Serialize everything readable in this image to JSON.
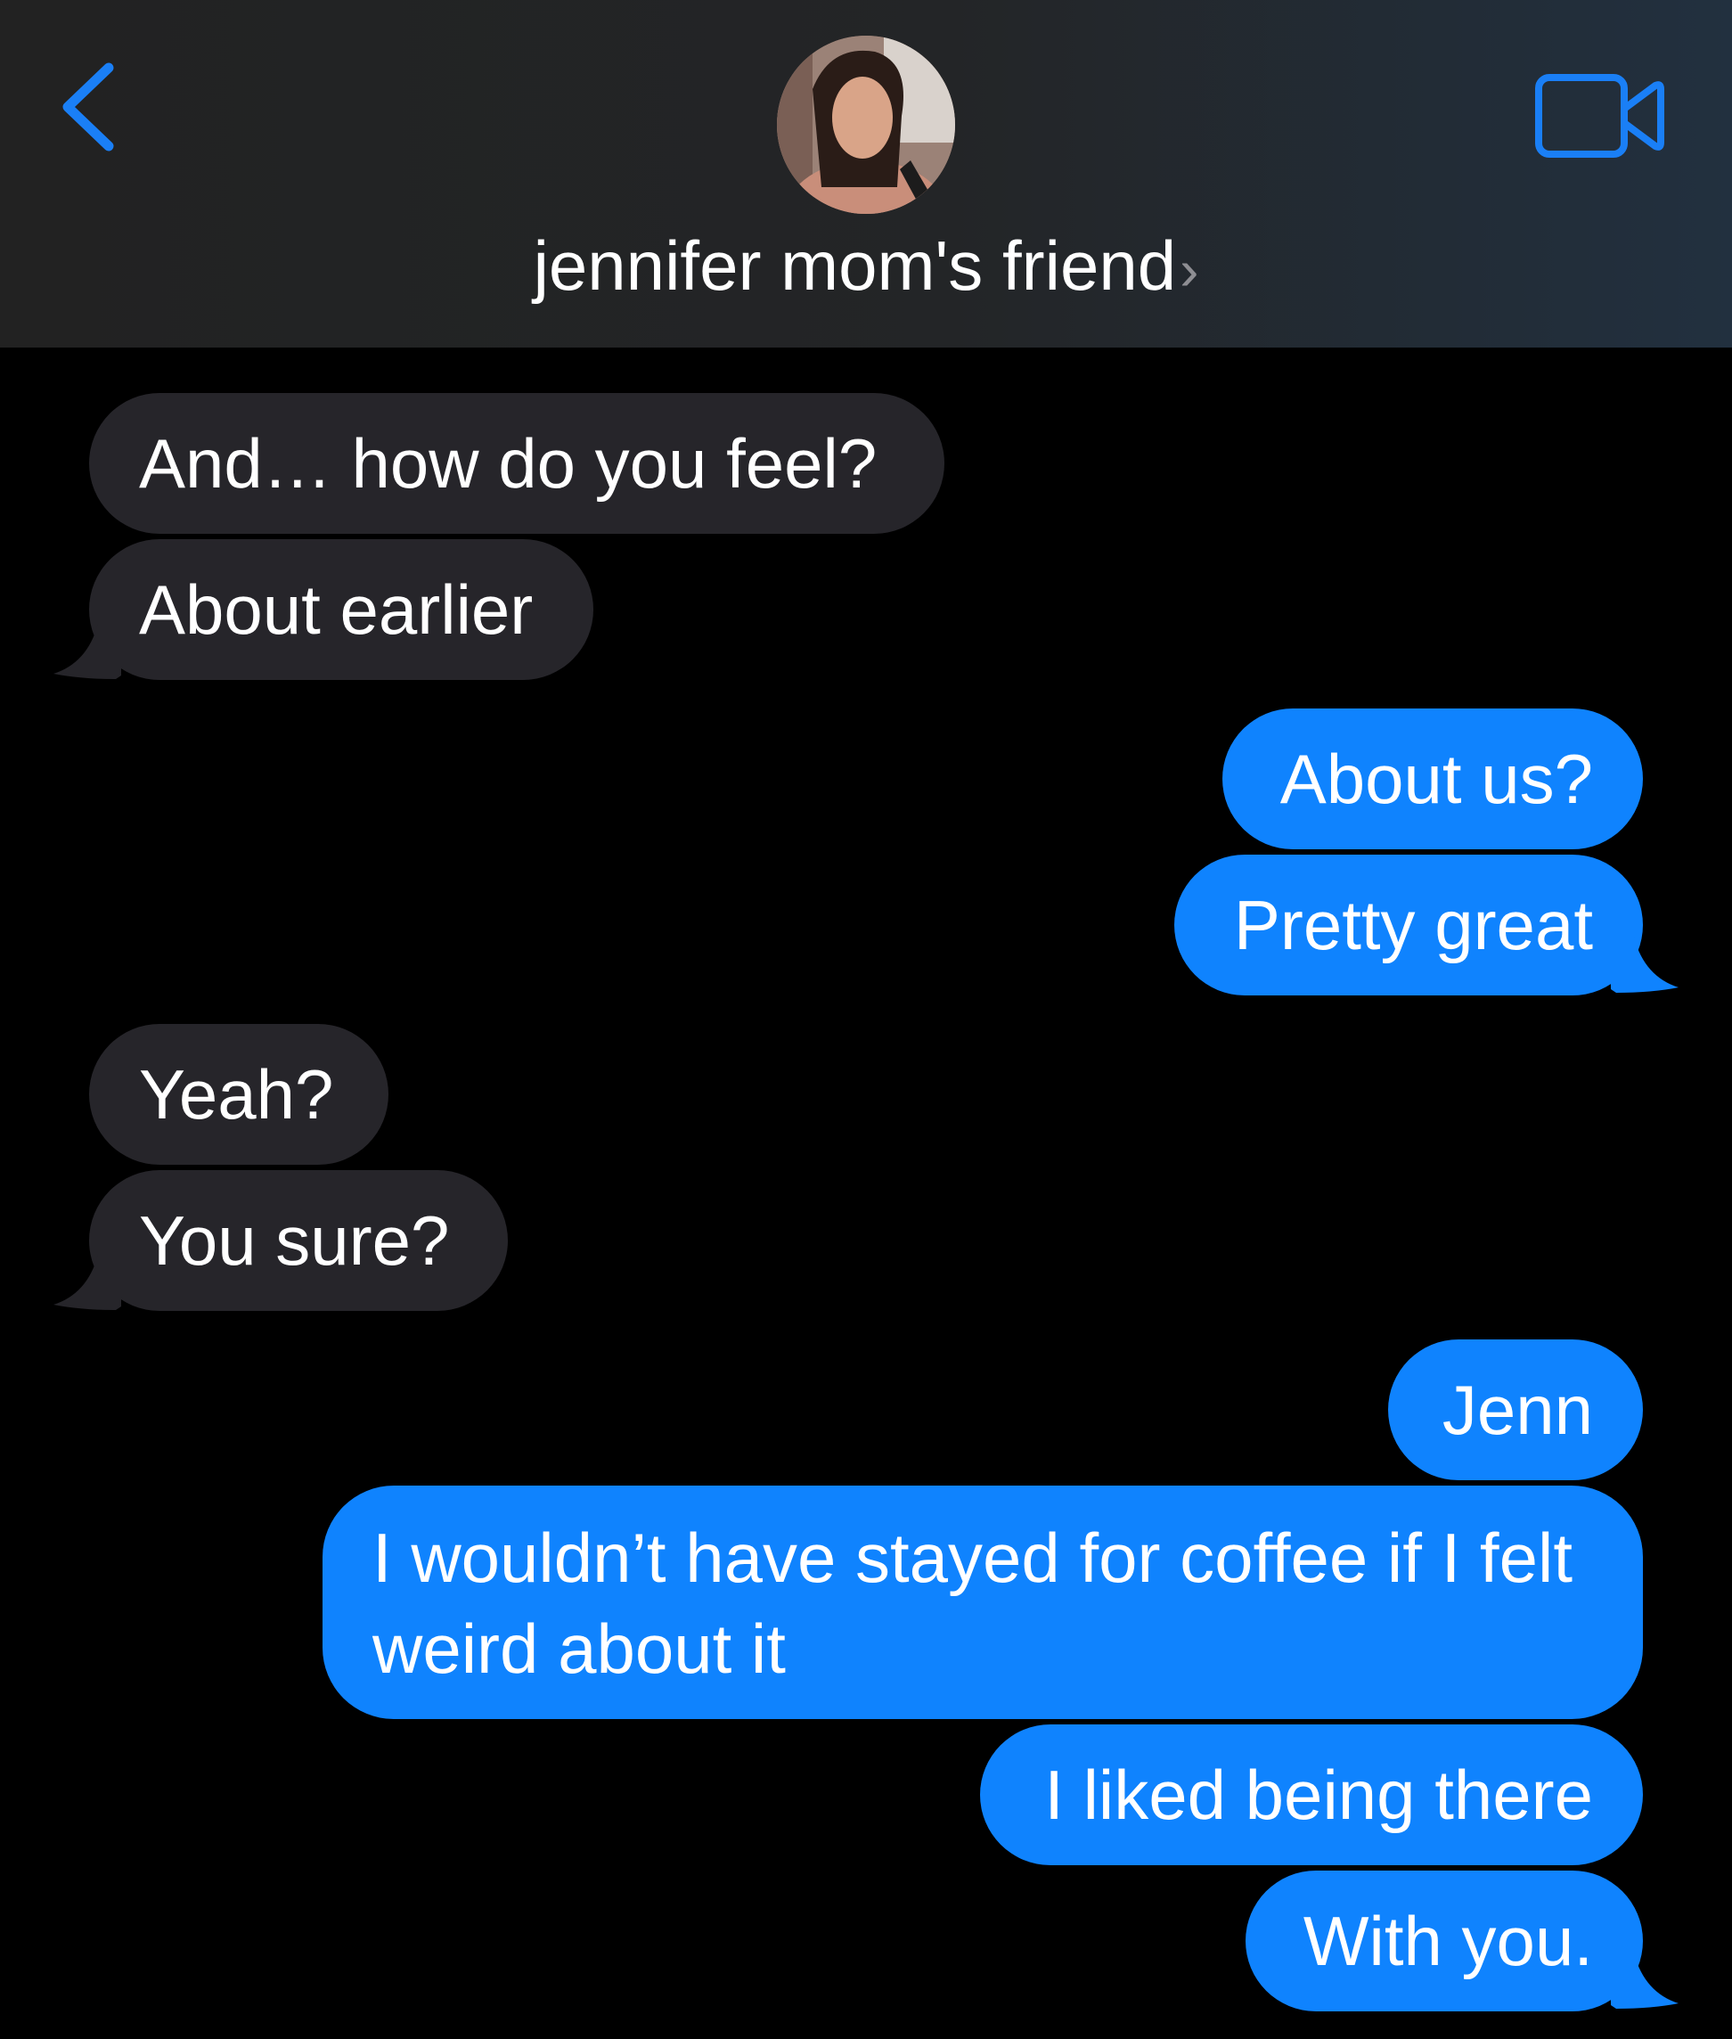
{
  "header": {
    "back_icon": "chevron-left-icon",
    "contact_name": "jennifer mom's friend",
    "chevron": "›",
    "video_icon": "video-camera-icon",
    "accent_color": "#1a7ff6"
  },
  "colors": {
    "incoming_bubble": "#26252a",
    "outgoing_bubble": "#0f83fe",
    "background": "#000000"
  },
  "messages": [
    {
      "direction": "incoming",
      "text": "And… how do you feel?"
    },
    {
      "direction": "incoming",
      "text": "About earlier"
    },
    {
      "direction": "outgoing",
      "text": "About us?"
    },
    {
      "direction": "outgoing",
      "text": "Pretty great"
    },
    {
      "direction": "incoming",
      "text": "Yeah?"
    },
    {
      "direction": "incoming",
      "text": "You sure?"
    },
    {
      "direction": "outgoing",
      "text": "Jenn"
    },
    {
      "direction": "outgoing",
      "text": "I wouldn’t have stayed for coffee if I felt weird about it"
    },
    {
      "direction": "outgoing",
      "text": "I liked being there"
    },
    {
      "direction": "outgoing",
      "text": "With you."
    }
  ]
}
